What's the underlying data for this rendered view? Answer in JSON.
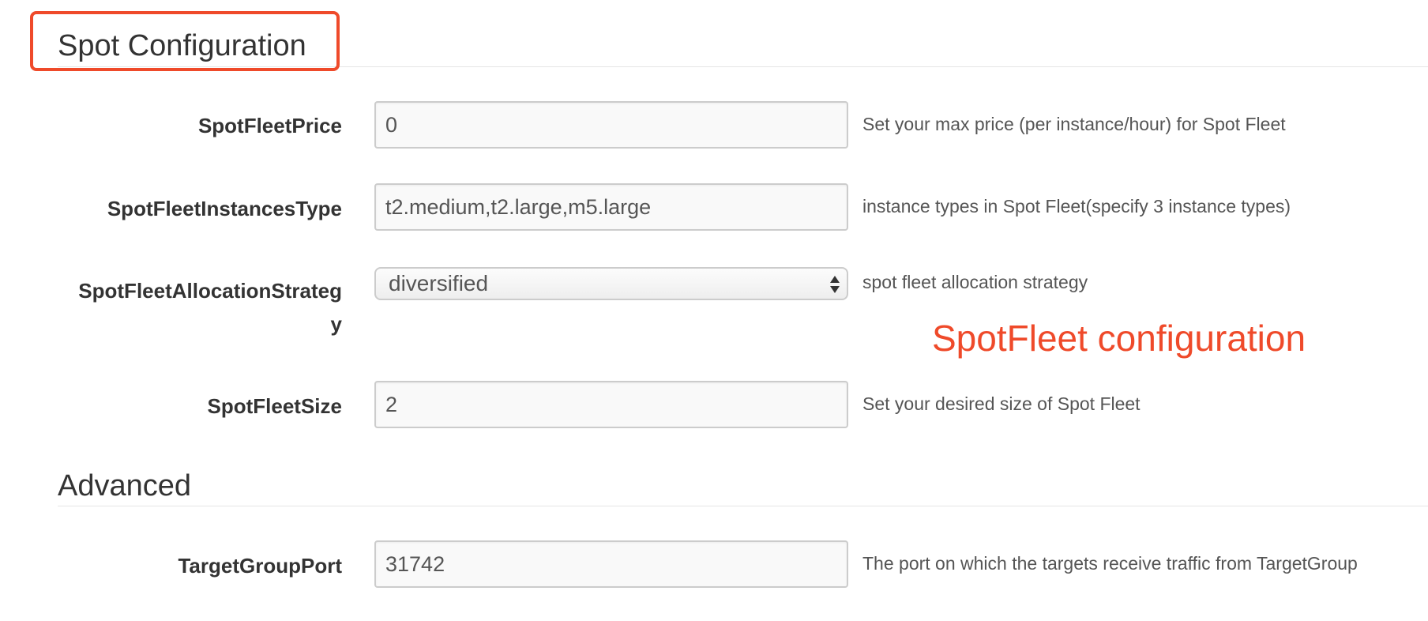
{
  "sections": {
    "spot": {
      "title": "Spot Configuration"
    },
    "advanced": {
      "title": "Advanced"
    }
  },
  "fields": {
    "spot_fleet_price": {
      "label": "SpotFleetPrice",
      "value": "0",
      "help": "Set your max price (per instance/hour) for Spot Fleet"
    },
    "spot_fleet_instances_type": {
      "label": "SpotFleetInstancesType",
      "value": "t2.medium,t2.large,m5.large",
      "help": "instance types in Spot Fleet(specify 3 instance types)"
    },
    "spot_fleet_allocation_strategy": {
      "label_line1": "SpotFleetAllocationStrateg",
      "label_line2": "y",
      "selected": "diversified",
      "help": "spot fleet allocation strategy"
    },
    "spot_fleet_size": {
      "label": "SpotFleetSize",
      "value": "2",
      "help": "Set your desired size of Spot Fleet"
    },
    "target_group_port": {
      "label": "TargetGroupPort",
      "value": "31742",
      "help": "The port on which the targets receive traffic from TargetGroup"
    }
  },
  "annotation": {
    "text": "SpotFleet configuration",
    "color": "#ef4a2a"
  }
}
